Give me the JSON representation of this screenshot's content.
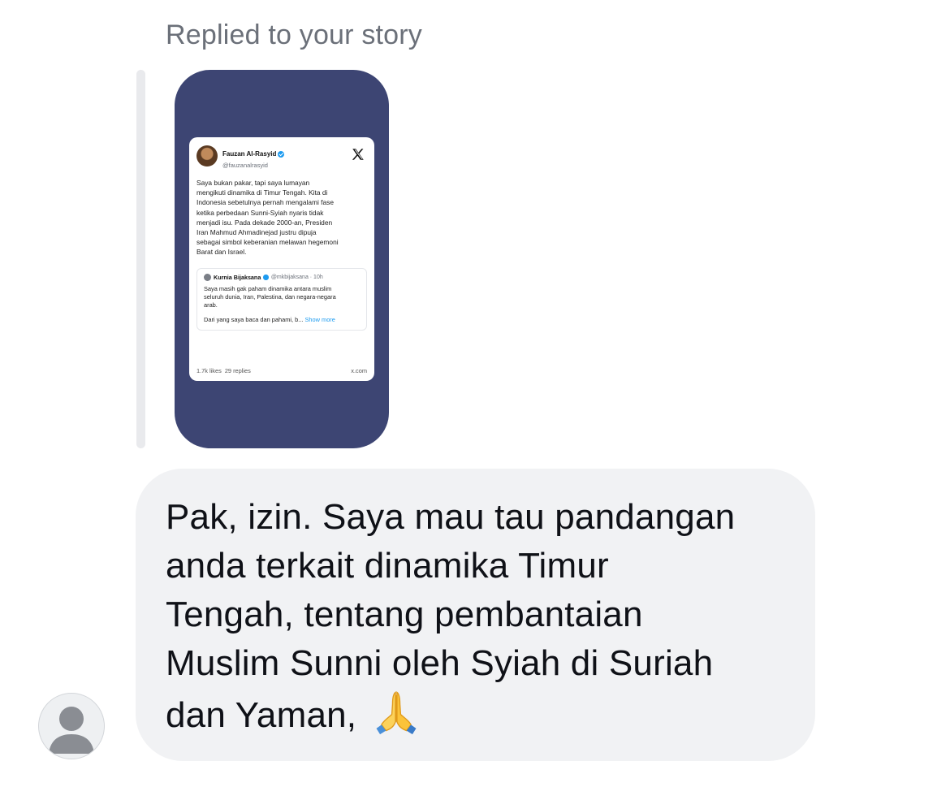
{
  "reply_context": {
    "label": "Replied to your story"
  },
  "story": {
    "background_color": "#3d4573",
    "tweet": {
      "author_name": "Fauzan Al-Rasyid",
      "author_handle": "@fauzanalrasyid",
      "platform_icon": "x-logo-icon",
      "body": "Saya bukan pakar, tapi saya lumayan\nmengikuti dinamika di Timur Tengah. Kita di\nIndonesia sebetulnya pernah mengalami fase\nketika perbedaan Sunni-Syiah nyaris tidak\nmenjadi isu. Pada dekade 2000-an, Presiden\nIran Mahmud Ahmadinejad justru dipuja\nsebagai simbol keberanian melawan hegemoni\nBarat dan Israel.",
      "quoted": {
        "author_name": "Kurnia Bijaksana",
        "author_handle": "@mkbijaksana · 10h",
        "body": "Saya masih gak paham dinamika antara muslim\nseluruh dunia, Iran, Palestina, dan negara-negara\narab.",
        "preview": "Dari yang saya baca dan pahami, b...",
        "show_more": "Show more"
      },
      "likes": "1.7k likes",
      "replies": "29 replies",
      "domain": "x.com"
    }
  },
  "message": {
    "text": "Pak, izin. Saya mau tau pandangan\nanda terkait dinamika Timur\nTengah, tentang pembantaian\nMuslim Sunni oleh Syiah di Suriah\ndan Yaman,",
    "emoji": "folded-hands-icon",
    "bubble_color": "#f1f2f4"
  },
  "sender": {
    "avatar": "default-person-avatar-icon"
  }
}
